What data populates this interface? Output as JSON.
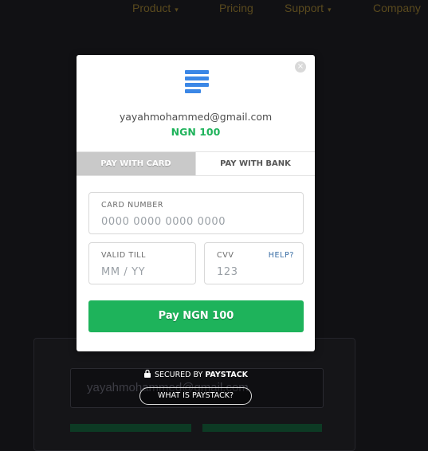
{
  "background": {
    "nav": {
      "items": [
        {
          "label": "Product",
          "caret": "▾"
        },
        {
          "label": "Pricing"
        },
        {
          "label": "Support",
          "caret": "▾"
        },
        {
          "label": "Company"
        }
      ]
    },
    "email_placeholder": "yayahmohammed@gmail.com"
  },
  "modal": {
    "merchant_logo_icon": "stacked-bars-logo",
    "email": "yayahmohammed@gmail.com",
    "amount": "NGN 100",
    "close_icon": "×",
    "tabs": [
      {
        "label": "PAY WITH CARD",
        "active": true
      },
      {
        "label": "PAY WITH BANK",
        "active": false
      }
    ],
    "card_number": {
      "label": "CARD NUMBER",
      "placeholder": "0000 0000 0000 0000"
    },
    "valid_till": {
      "label": "VALID TILL",
      "placeholder": "MM / YY"
    },
    "cvv": {
      "label": "CVV",
      "placeholder": "123",
      "help": "HELP?"
    },
    "pay_button": "Pay NGN 100"
  },
  "footer": {
    "secured_prefix": "SECURED BY",
    "secured_brand": "PAYSTACK",
    "what_is": "WHAT IS PAYSTACK?"
  },
  "colors": {
    "accent_green": "#1eb35b",
    "link_blue": "#3a6ea5",
    "logo_blue": "#3b87e6"
  }
}
